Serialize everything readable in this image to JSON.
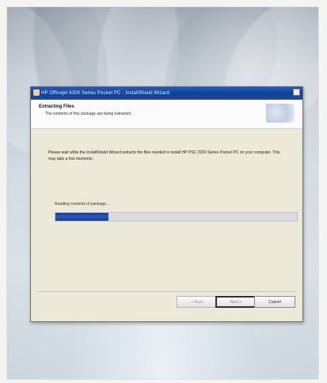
{
  "window": {
    "title": "HP Officejet 6300 Series Pocket PC - InstallShield Wizard",
    "accent": "#1d56b8"
  },
  "header": {
    "title": "Extracting Files",
    "subtitle": "The contents of this package are being extracted."
  },
  "body": {
    "message": "Please wait while the InstallShield Wizard extracts the files needed to install HP PSC 2200 Series Pocket PC on your computer. This may take a few moments.",
    "status": "Reading contents of package...",
    "progress_fraction": 0.22
  },
  "buttons": {
    "back": "< Back",
    "next": "Next >",
    "cancel": "Cancel"
  }
}
